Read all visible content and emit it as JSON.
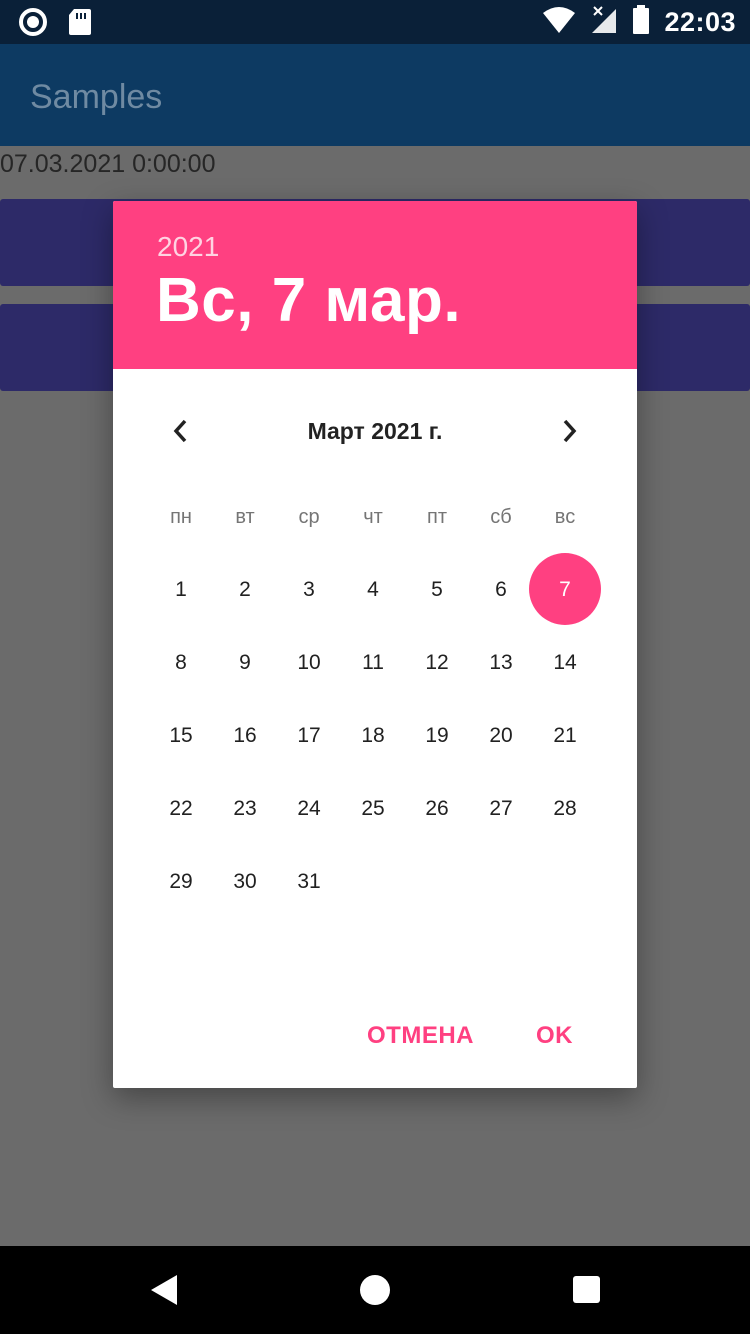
{
  "status_bar": {
    "time": "22:03"
  },
  "app_bar": {
    "title": "Samples"
  },
  "main": {
    "date_text": "07.03.2021 0:00:00"
  },
  "dialog": {
    "year": "2021",
    "selected_date": "Вс, 7 мар.",
    "month_title": "Март 2021 г.",
    "weekdays": [
      "пн",
      "вт",
      "ср",
      "чт",
      "пт",
      "сб",
      "вс"
    ],
    "weeks": [
      [
        "1",
        "2",
        "3",
        "4",
        "5",
        "6",
        "7"
      ],
      [
        "8",
        "9",
        "10",
        "11",
        "12",
        "13",
        "14"
      ],
      [
        "15",
        "16",
        "17",
        "18",
        "19",
        "20",
        "21"
      ],
      [
        "22",
        "23",
        "24",
        "25",
        "26",
        "27",
        "28"
      ],
      [
        "29",
        "30",
        "31",
        "",
        "",
        "",
        ""
      ]
    ],
    "selected_day": "7",
    "cancel_label": "ОТМЕНА",
    "ok_label": "OK"
  },
  "colors": {
    "accent": "#ff4081",
    "app_bar": "#0d3a62",
    "button": "#2d2a68"
  }
}
